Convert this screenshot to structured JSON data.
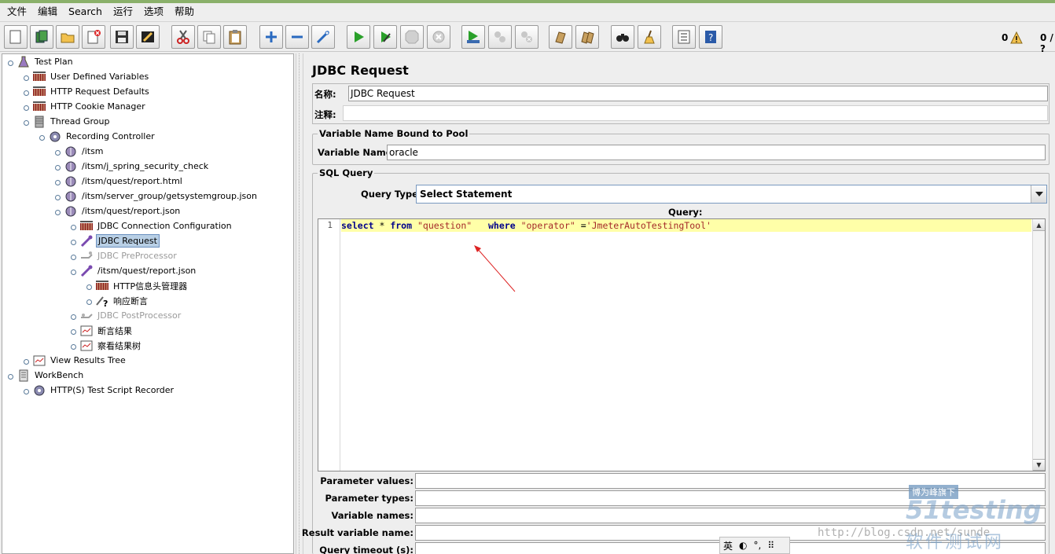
{
  "menu": [
    "文件",
    "编辑",
    "Search",
    "运行",
    "选项",
    "帮助"
  ],
  "toolbar": {
    "error_count": "0",
    "active_threads": "0 / ?"
  },
  "tree": [
    {
      "label": "Test Plan",
      "level": 0,
      "icon": "flask-icon",
      "state": "normal"
    },
    {
      "label": "User Defined Variables",
      "level": 1,
      "icon": "config-element-icon",
      "state": "normal"
    },
    {
      "label": "HTTP Request Defaults",
      "level": 1,
      "icon": "config-element-icon",
      "state": "normal"
    },
    {
      "label": "HTTP Cookie Manager",
      "level": 1,
      "icon": "config-element-icon",
      "state": "normal"
    },
    {
      "label": "Thread Group",
      "level": 1,
      "icon": "thread-group-icon",
      "state": "normal"
    },
    {
      "label": "Recording Controller",
      "level": 2,
      "icon": "controller-icon",
      "state": "normal"
    },
    {
      "label": "/itsm",
      "level": 3,
      "icon": "sampler-icon",
      "state": "normal"
    },
    {
      "label": "/itsm/j_spring_security_check",
      "level": 3,
      "icon": "sampler-icon",
      "state": "normal"
    },
    {
      "label": "/itsm/quest/report.html",
      "level": 3,
      "icon": "sampler-icon",
      "state": "normal"
    },
    {
      "label": "/itsm/server_group/getsystemgroup.json",
      "level": 3,
      "icon": "sampler-icon",
      "state": "normal"
    },
    {
      "label": "/itsm/quest/report.json",
      "level": 3,
      "icon": "sampler-icon",
      "state": "normal"
    },
    {
      "label": "JDBC Connection Configuration",
      "level": 4,
      "icon": "config-element-icon",
      "state": "normal"
    },
    {
      "label": "JDBC Request",
      "level": 4,
      "icon": "pipette-icon",
      "state": "selected"
    },
    {
      "label": "JDBC PreProcessor",
      "level": 4,
      "icon": "preprocessor-icon",
      "state": "disabled"
    },
    {
      "label": "/itsm/quest/report.json",
      "level": 4,
      "icon": "pipette-icon",
      "state": "normal"
    },
    {
      "label": "HTTP信息头管理器",
      "level": 5,
      "icon": "config-element-icon",
      "state": "normal"
    },
    {
      "label": "响应断言",
      "level": 5,
      "icon": "assertion-icon",
      "state": "normal"
    },
    {
      "label": "JDBC PostProcessor",
      "level": 4,
      "icon": "postprocessor-icon",
      "state": "disabled"
    },
    {
      "label": "断言结果",
      "level": 4,
      "icon": "listener-icon",
      "state": "normal"
    },
    {
      "label": "察看结果树",
      "level": 4,
      "icon": "listener-icon",
      "state": "normal"
    },
    {
      "label": "View Results Tree",
      "level": 1,
      "icon": "listener-icon",
      "state": "normal"
    },
    {
      "label": "WorkBench",
      "level": 0,
      "icon": "workbench-icon",
      "state": "normal"
    },
    {
      "label": "HTTP(S) Test Script Recorder",
      "level": 1,
      "icon": "controller-icon",
      "state": "normal"
    }
  ],
  "panel": {
    "title": "JDBC Request",
    "name_label": "名称:",
    "name_value": "JDBC Request",
    "comment_label": "注释:",
    "comment_value": "",
    "pool_group_title": "Variable Name Bound to Pool",
    "variable_name_label": "Variable Name:",
    "variable_name_value": "oracle",
    "sql_group_title": "SQL Query",
    "query_type_label": "Query Type:",
    "query_type_value": "Select Statement",
    "query_label": "Query:",
    "line_number": "1",
    "code": {
      "t1": "select",
      "t2": " * ",
      "t3": "from",
      "t4": " ",
      "t5": "\"question\"",
      "t6": "   ",
      "t7": "where",
      "t8": " ",
      "t9": "\"operator\"",
      "t10": " =",
      "t11": "'JmeterAutoTestingTool'"
    },
    "params": [
      {
        "label": "Parameter values:",
        "value": ""
      },
      {
        "label": "Parameter types:",
        "value": ""
      },
      {
        "label": "Variable names:",
        "value": ""
      },
      {
        "label": "Result variable name:",
        "value": ""
      },
      {
        "label": "Query timeout (s):",
        "value": ""
      }
    ]
  },
  "watermark": {
    "url": "http://blog.csdn.net/sunde",
    "tag": "博为峰旗下",
    "logo": "51testing",
    "cn": "软件测试网"
  },
  "ime": {
    "lang": "英"
  }
}
